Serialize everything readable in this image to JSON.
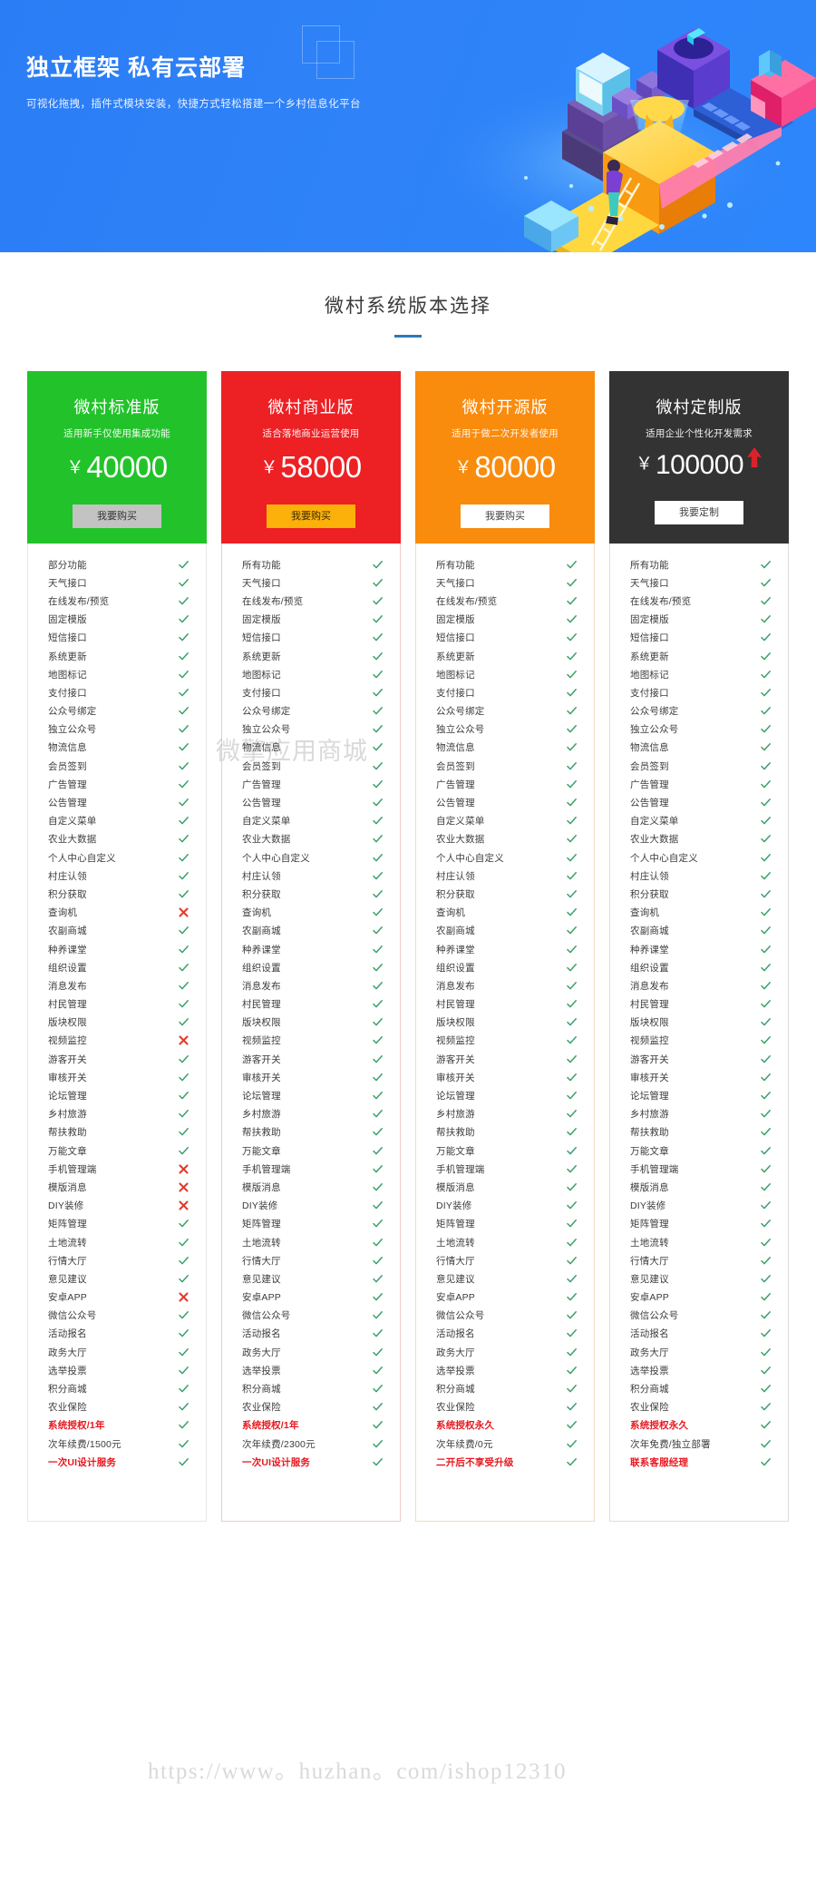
{
  "hero": {
    "title": "独立框架 私有云部署",
    "subtitle": "可视化拖拽，插件式模块安装，快捷方式轻松搭建一个乡村信息化平台"
  },
  "section": {
    "title": "微村系统版本选择"
  },
  "watermarks": {
    "shop": "微擎应用商城",
    "url": "https://www。huzhan。com/ishop12310"
  },
  "colors": {
    "standard": "#22c32a",
    "business": "#ed2024",
    "opensource": "#f98b0d",
    "custom": "#333333",
    "check": "#3aa06a",
    "cross": "#e03b2f",
    "highlight": "#e8171e",
    "hero": "#2f82f7",
    "rule": "#2a7ab9"
  },
  "plans": [
    {
      "name": "微村标准版",
      "desc": "适用新手仅使用集成功能",
      "currency": "￥",
      "price": "40000",
      "button": "我要购买",
      "arrow": false
    },
    {
      "name": "微村商业版",
      "desc": "适合落地商业运营使用",
      "currency": "￥",
      "price": "58000",
      "button": "我要购买",
      "arrow": false
    },
    {
      "name": "微村开源版",
      "desc": "适用于做二次开发者使用",
      "currency": "￥",
      "price": "80000",
      "button": "我要购买",
      "arrow": false
    },
    {
      "name": "微村定制版",
      "desc": "适用企业个性化开发需求",
      "currency": "￥",
      "price": "100000",
      "button": "我要定制",
      "arrow": true
    }
  ],
  "features": [
    {
      "labels": [
        "部分功能",
        "所有功能",
        "所有功能",
        "所有功能"
      ],
      "marks": [
        "check",
        "check",
        "check",
        "check"
      ]
    },
    {
      "labels": [
        "天气接口",
        "天气接口",
        "天气接口",
        "天气接口"
      ],
      "marks": [
        "check",
        "check",
        "check",
        "check"
      ]
    },
    {
      "labels": [
        "在线发布/预览",
        "在线发布/预览",
        "在线发布/预览",
        "在线发布/预览"
      ],
      "marks": [
        "check",
        "check",
        "check",
        "check"
      ]
    },
    {
      "labels": [
        "固定模版",
        "固定模版",
        "固定模版",
        "固定模版"
      ],
      "marks": [
        "check",
        "check",
        "check",
        "check"
      ]
    },
    {
      "labels": [
        "短信接口",
        "短信接口",
        "短信接口",
        "短信接口"
      ],
      "marks": [
        "check",
        "check",
        "check",
        "check"
      ]
    },
    {
      "labels": [
        "系统更新",
        "系统更新",
        "系统更新",
        "系统更新"
      ],
      "marks": [
        "check",
        "check",
        "check",
        "check"
      ]
    },
    {
      "labels": [
        "地图标记",
        "地图标记",
        "地图标记",
        "地图标记"
      ],
      "marks": [
        "check",
        "check",
        "check",
        "check"
      ]
    },
    {
      "labels": [
        "支付接口",
        "支付接口",
        "支付接口",
        "支付接口"
      ],
      "marks": [
        "check",
        "check",
        "check",
        "check"
      ]
    },
    {
      "labels": [
        "公众号绑定",
        "公众号绑定",
        "公众号绑定",
        "公众号绑定"
      ],
      "marks": [
        "check",
        "check",
        "check",
        "check"
      ]
    },
    {
      "labels": [
        "独立公众号",
        "独立公众号",
        "独立公众号",
        "独立公众号"
      ],
      "marks": [
        "check",
        "check",
        "check",
        "check"
      ]
    },
    {
      "labels": [
        "物流信息",
        "物流信息",
        "物流信息",
        "物流信息"
      ],
      "marks": [
        "check",
        "check",
        "check",
        "check"
      ]
    },
    {
      "labels": [
        "会员签到",
        "会员签到",
        "会员签到",
        "会员签到"
      ],
      "marks": [
        "check",
        "check",
        "check",
        "check"
      ]
    },
    {
      "labels": [
        "广告管理",
        "广告管理",
        "广告管理",
        "广告管理"
      ],
      "marks": [
        "check",
        "check",
        "check",
        "check"
      ]
    },
    {
      "labels": [
        "公告管理",
        "公告管理",
        "公告管理",
        "公告管理"
      ],
      "marks": [
        "check",
        "check",
        "check",
        "check"
      ]
    },
    {
      "labels": [
        "自定义菜单",
        "自定义菜单",
        "自定义菜单",
        "自定义菜单"
      ],
      "marks": [
        "check",
        "check",
        "check",
        "check"
      ]
    },
    {
      "labels": [
        "农业大数据",
        "农业大数据",
        "农业大数据",
        "农业大数据"
      ],
      "marks": [
        "check",
        "check",
        "check",
        "check"
      ]
    },
    {
      "labels": [
        "个人中心自定义",
        "个人中心自定义",
        "个人中心自定义",
        "个人中心自定义"
      ],
      "marks": [
        "check",
        "check",
        "check",
        "check"
      ]
    },
    {
      "labels": [
        "村庄认领",
        "村庄认领",
        "村庄认领",
        "村庄认领"
      ],
      "marks": [
        "check",
        "check",
        "check",
        "check"
      ]
    },
    {
      "labels": [
        "积分获取",
        "积分获取",
        "积分获取",
        "积分获取"
      ],
      "marks": [
        "check",
        "check",
        "check",
        "check"
      ]
    },
    {
      "labels": [
        "查询机",
        "查询机",
        "查询机",
        "查询机"
      ],
      "marks": [
        "cross",
        "check",
        "check",
        "check"
      ]
    },
    {
      "labels": [
        "农副商城",
        "农副商城",
        "农副商城",
        "农副商城"
      ],
      "marks": [
        "check",
        "check",
        "check",
        "check"
      ]
    },
    {
      "labels": [
        "种养课堂",
        "种养课堂",
        "种养课堂",
        "种养课堂"
      ],
      "marks": [
        "check",
        "check",
        "check",
        "check"
      ]
    },
    {
      "labels": [
        "组织设置",
        "组织设置",
        "组织设置",
        "组织设置"
      ],
      "marks": [
        "check",
        "check",
        "check",
        "check"
      ]
    },
    {
      "labels": [
        "消息发布",
        "消息发布",
        "消息发布",
        "消息发布"
      ],
      "marks": [
        "check",
        "check",
        "check",
        "check"
      ]
    },
    {
      "labels": [
        "村民管理",
        "村民管理",
        "村民管理",
        "村民管理"
      ],
      "marks": [
        "check",
        "check",
        "check",
        "check"
      ]
    },
    {
      "labels": [
        "版块权限",
        "版块权限",
        "版块权限",
        "版块权限"
      ],
      "marks": [
        "check",
        "check",
        "check",
        "check"
      ]
    },
    {
      "labels": [
        "视频监控",
        "视频监控",
        "视频监控",
        "视频监控"
      ],
      "marks": [
        "cross",
        "check",
        "check",
        "check"
      ]
    },
    {
      "labels": [
        "游客开关",
        "游客开关",
        "游客开关",
        "游客开关"
      ],
      "marks": [
        "check",
        "check",
        "check",
        "check"
      ]
    },
    {
      "labels": [
        "审核开关",
        "审核开关",
        "审核开关",
        "审核开关"
      ],
      "marks": [
        "check",
        "check",
        "check",
        "check"
      ]
    },
    {
      "labels": [
        "论坛管理",
        "论坛管理",
        "论坛管理",
        "论坛管理"
      ],
      "marks": [
        "check",
        "check",
        "check",
        "check"
      ]
    },
    {
      "labels": [
        "乡村旅游",
        "乡村旅游",
        "乡村旅游",
        "乡村旅游"
      ],
      "marks": [
        "check",
        "check",
        "check",
        "check"
      ]
    },
    {
      "labels": [
        "帮扶救助",
        "帮扶救助",
        "帮扶救助",
        "帮扶救助"
      ],
      "marks": [
        "check",
        "check",
        "check",
        "check"
      ]
    },
    {
      "labels": [
        "万能文章",
        "万能文章",
        "万能文章",
        "万能文章"
      ],
      "marks": [
        "check",
        "check",
        "check",
        "check"
      ]
    },
    {
      "labels": [
        "手机管理端",
        "手机管理端",
        "手机管理端",
        "手机管理端"
      ],
      "marks": [
        "cross",
        "check",
        "check",
        "check"
      ]
    },
    {
      "labels": [
        "模版消息",
        "模版消息",
        "模版消息",
        "模版消息"
      ],
      "marks": [
        "cross",
        "check",
        "check",
        "check"
      ]
    },
    {
      "labels": [
        "DIY装修",
        "DIY装修",
        "DIY装修",
        "DIY装修"
      ],
      "marks": [
        "cross",
        "check",
        "check",
        "check"
      ]
    },
    {
      "labels": [
        "矩阵管理",
        "矩阵管理",
        "矩阵管理",
        "矩阵管理"
      ],
      "marks": [
        "check",
        "check",
        "check",
        "check"
      ]
    },
    {
      "labels": [
        "土地流转",
        "土地流转",
        "土地流转",
        "土地流转"
      ],
      "marks": [
        "check",
        "check",
        "check",
        "check"
      ]
    },
    {
      "labels": [
        "行情大厅",
        "行情大厅",
        "行情大厅",
        "行情大厅"
      ],
      "marks": [
        "check",
        "check",
        "check",
        "check"
      ]
    },
    {
      "labels": [
        "意见建议",
        "意见建议",
        "意见建议",
        "意见建议"
      ],
      "marks": [
        "check",
        "check",
        "check",
        "check"
      ]
    },
    {
      "labels": [
        "安卓APP",
        "安卓APP",
        "安卓APP",
        "安卓APP"
      ],
      "marks": [
        "cross",
        "check",
        "check",
        "check"
      ]
    },
    {
      "labels": [
        "微信公众号",
        "微信公众号",
        "微信公众号",
        "微信公众号"
      ],
      "marks": [
        "check",
        "check",
        "check",
        "check"
      ]
    },
    {
      "labels": [
        "活动报名",
        "活动报名",
        "活动报名",
        "活动报名"
      ],
      "marks": [
        "check",
        "check",
        "check",
        "check"
      ]
    },
    {
      "labels": [
        "政务大厅",
        "政务大厅",
        "政务大厅",
        "政务大厅"
      ],
      "marks": [
        "check",
        "check",
        "check",
        "check"
      ]
    },
    {
      "labels": [
        "选举投票",
        "选举投票",
        "选举投票",
        "选举投票"
      ],
      "marks": [
        "check",
        "check",
        "check",
        "check"
      ]
    },
    {
      "labels": [
        "积分商城",
        "积分商城",
        "积分商城",
        "积分商城"
      ],
      "marks": [
        "check",
        "check",
        "check",
        "check"
      ]
    },
    {
      "labels": [
        "农业保险",
        "农业保险",
        "农业保险",
        "农业保险"
      ],
      "marks": [
        "check",
        "check",
        "check",
        "check"
      ]
    },
    {
      "labels": [
        "系统授权/1年",
        "系统授权/1年",
        "系统授权永久",
        "系统授权永久"
      ],
      "marks": [
        "check",
        "check",
        "check",
        "check"
      ],
      "highlight": [
        true,
        true,
        true,
        true
      ]
    },
    {
      "labels": [
        "次年续费/1500元",
        "次年续费/2300元",
        "次年续费/0元",
        "次年免费/独立部署"
      ],
      "marks": [
        "check",
        "check",
        "check",
        "check"
      ]
    },
    {
      "labels": [
        "一次UI设计服务",
        "一次UI设计服务",
        "二开后不享受升级",
        "联系客服经理"
      ],
      "marks": [
        "check",
        "check",
        "check",
        "check"
      ],
      "highlight": [
        true,
        true,
        true,
        true
      ]
    }
  ]
}
